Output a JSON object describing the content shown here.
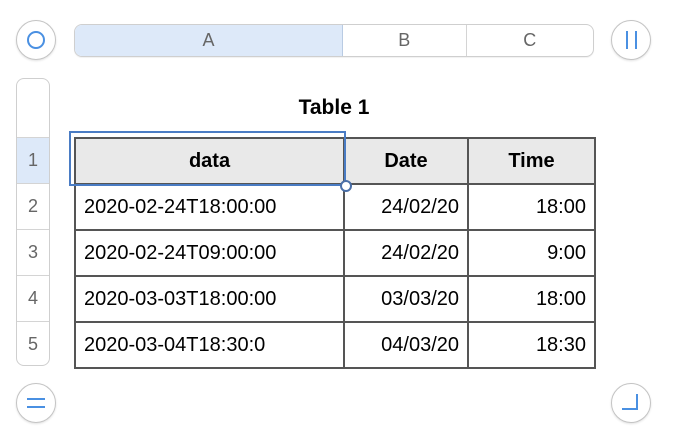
{
  "column_headers": [
    "A",
    "B",
    "C"
  ],
  "row_headers": [
    "1",
    "2",
    "3",
    "4",
    "5"
  ],
  "table": {
    "title": "Table 1",
    "header": [
      "data",
      "Date",
      "Time"
    ],
    "rows": [
      [
        "2020-02-24T18:00:00",
        "24/02/20",
        "18:00"
      ],
      [
        "2020-02-24T09:00:00",
        "24/02/20",
        "9:00"
      ],
      [
        "2020-03-03T18:00:00",
        "03/03/20",
        "18:00"
      ],
      [
        "2020-03-04T18:30:0",
        "04/03/20",
        "18:30"
      ]
    ]
  },
  "colors": {
    "accent": "#4a90e2",
    "selection": "#4a7cc4",
    "header_selected": "#dde9f9"
  }
}
